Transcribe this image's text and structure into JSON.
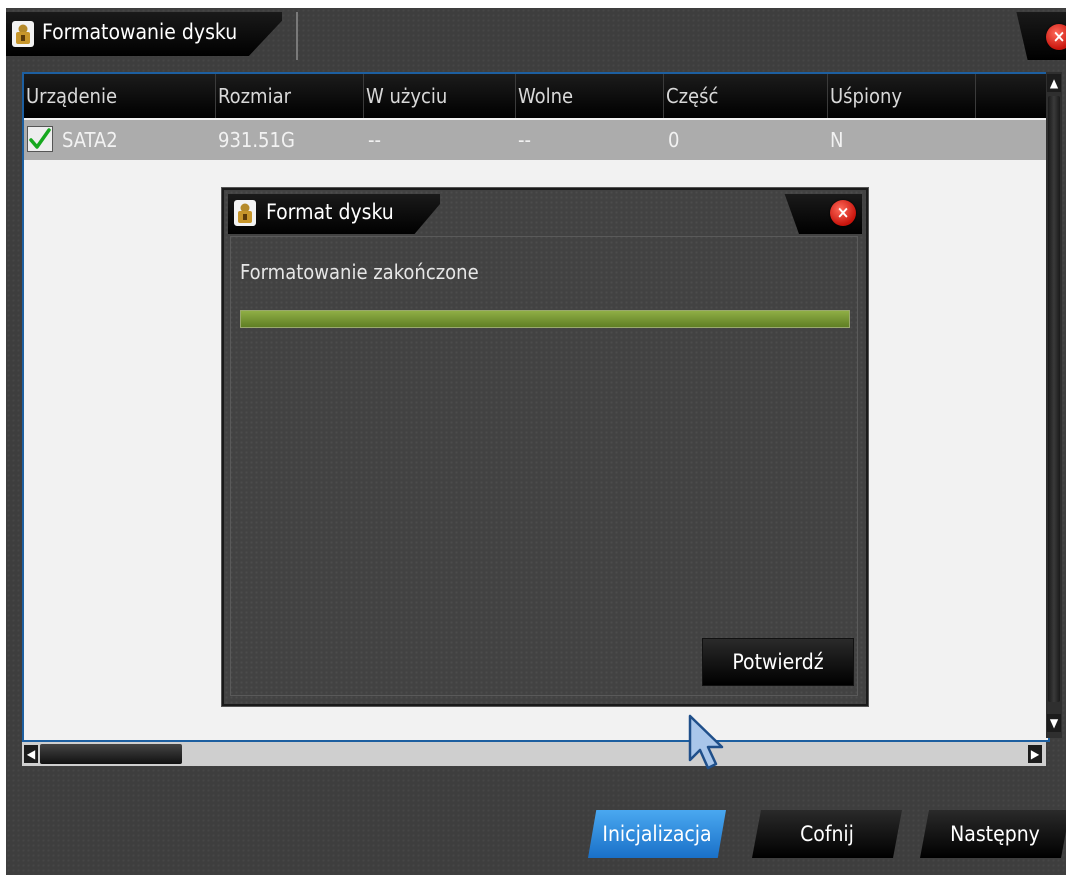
{
  "window": {
    "title": "Formatowanie dysku",
    "title_icon": "lock-icon",
    "close_icon": "close-icon"
  },
  "table": {
    "columns": [
      "Urządenie",
      "Rozmiar",
      "W użyciu",
      "Wolne",
      "Część",
      "Uśpiony"
    ],
    "rows": [
      {
        "checked": true,
        "device": "SATA2",
        "size": "931.51G",
        "used": "--",
        "free": "--",
        "part": "0",
        "sleep": "N"
      }
    ]
  },
  "dialog": {
    "title": "Format dysku",
    "title_icon": "lock-icon",
    "close_icon": "close-icon",
    "status": "Formatowanie zakończone",
    "progress": 1.0,
    "confirm_label": "Potwierdź"
  },
  "footer": {
    "init_label": "Inicjalizacja",
    "back_label": "Cofnij",
    "next_label": "Następny"
  },
  "colors": {
    "accent": "#1a70c8",
    "progress": "#7a9a35",
    "close": "#d42a1e"
  }
}
